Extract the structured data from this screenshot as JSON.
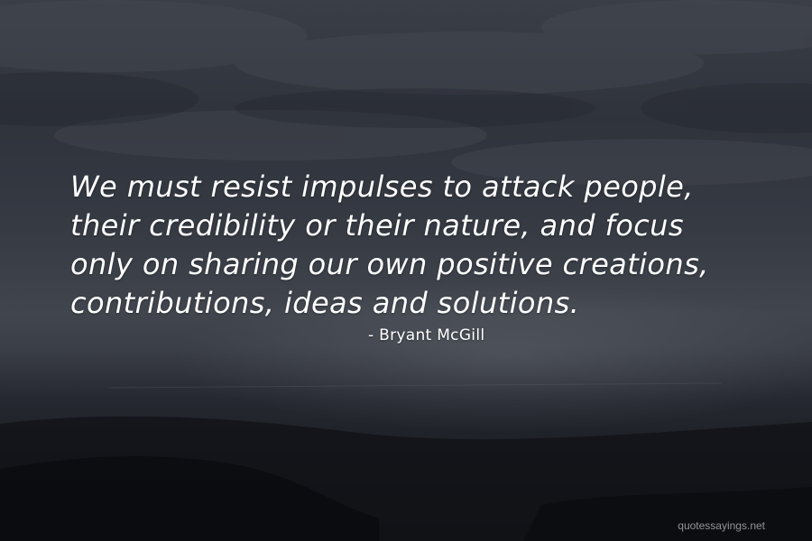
{
  "quote": {
    "lines": [
      "We must resist impulses to attack people,",
      "their credibility or their nature, and focus",
      "only on sharing our own positive creations,",
      "contributions, ideas and solutions."
    ],
    "author": "- Bryant McGill"
  },
  "watermark": "quotessayings.net",
  "colors": {
    "text": "#ffffff",
    "sky": "#3a3e47",
    "sea": "#14161a"
  }
}
